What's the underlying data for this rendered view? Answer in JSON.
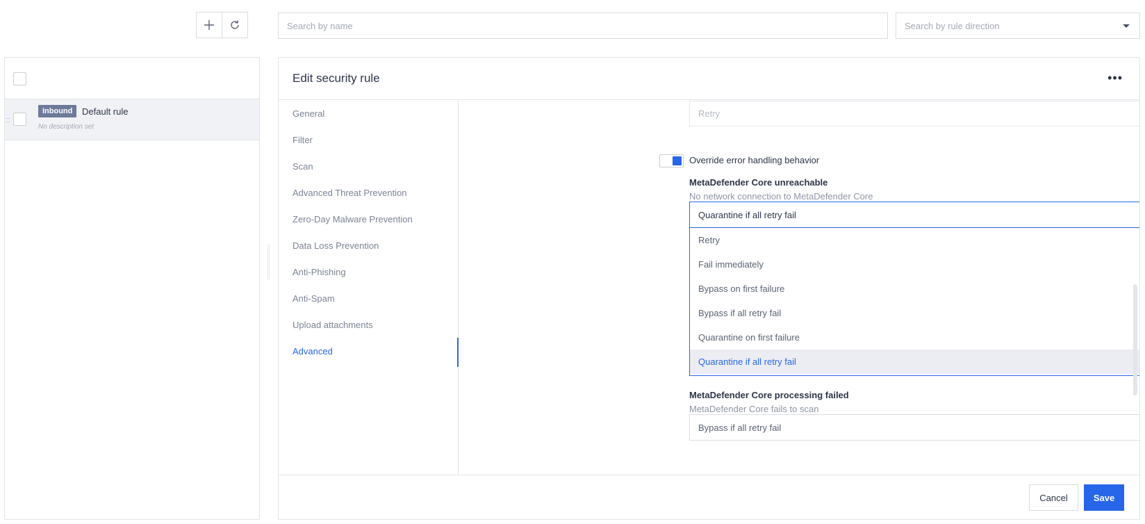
{
  "toolbar": {
    "add_icon": "plus-icon",
    "refresh_icon": "refresh-icon"
  },
  "search": {
    "name_placeholder": "Search by name",
    "direction_placeholder": "Search by rule direction"
  },
  "rules_list": {
    "items": [
      {
        "direction_badge": "Inbound",
        "name": "Default rule",
        "description": "No description set"
      }
    ]
  },
  "editor": {
    "title": "Edit security rule",
    "more_icon": "more-horizontal-icon",
    "nav": [
      {
        "label": "General",
        "active": false
      },
      {
        "label": "Filter",
        "active": false
      },
      {
        "label": "Scan",
        "active": false
      },
      {
        "label": "Advanced Threat Prevention",
        "active": false
      },
      {
        "label": "Zero-Day Malware Prevention",
        "active": false
      },
      {
        "label": "Data Loss Prevention",
        "active": false
      },
      {
        "label": "Anti-Phishing",
        "active": false
      },
      {
        "label": "Anti-Spam",
        "active": false
      },
      {
        "label": "Upload attachments",
        "active": false
      },
      {
        "label": "Advanced",
        "active": true
      }
    ],
    "advanced": {
      "previous_select_value": "Retry",
      "override_toggle": {
        "label": "Override error handling behavior",
        "on": true
      },
      "unreachable": {
        "title": "MetaDefender Core unreachable",
        "subtitle": "No network connection to MetaDefender Core",
        "selected": "Quarantine if all retry fail",
        "options": [
          "Retry",
          "Fail immediately",
          "Bypass on first failure",
          "Bypass if all retry fail",
          "Quarantine on first failure",
          "Quarantine if all retry fail"
        ]
      },
      "processing_failed": {
        "title": "MetaDefender Core processing failed",
        "subtitle": "MetaDefender Core fails to scan",
        "selected": "Bypass if all retry fail"
      }
    },
    "footer": {
      "cancel_label": "Cancel",
      "save_label": "Save"
    }
  },
  "colors": {
    "accent": "#2766e8",
    "badge": "#6d7a99",
    "selected_option_bg": "#ecedf3"
  }
}
